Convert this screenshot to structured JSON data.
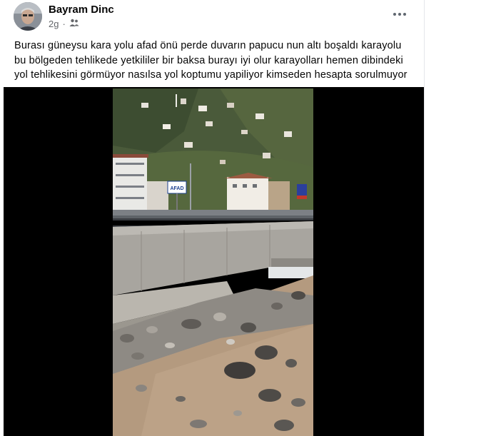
{
  "post": {
    "author": "Bayram Dinc",
    "time": "2g",
    "audience_icon": "friends-icon",
    "more_icon": "more-options-icon",
    "text_lines": [
      "Burası güneysu kara yolu afad önü perde duvarın papucu nun altı boşaldı karayolu",
      "bu bölgeden  tehlikede yetkililer bir baksa burayı iyi olur karayolları hemen dibindeki",
      "yol tehlikesini görmüyor nasılsa yol koptumu yapiliyor kimseden hesapta sorulmuyor"
    ]
  },
  "video": {
    "sign_text": "AFAD"
  },
  "colors": {
    "text": "#050505",
    "meta": "#65676b",
    "media_bg": "#000000",
    "water": "#b49a7f"
  }
}
